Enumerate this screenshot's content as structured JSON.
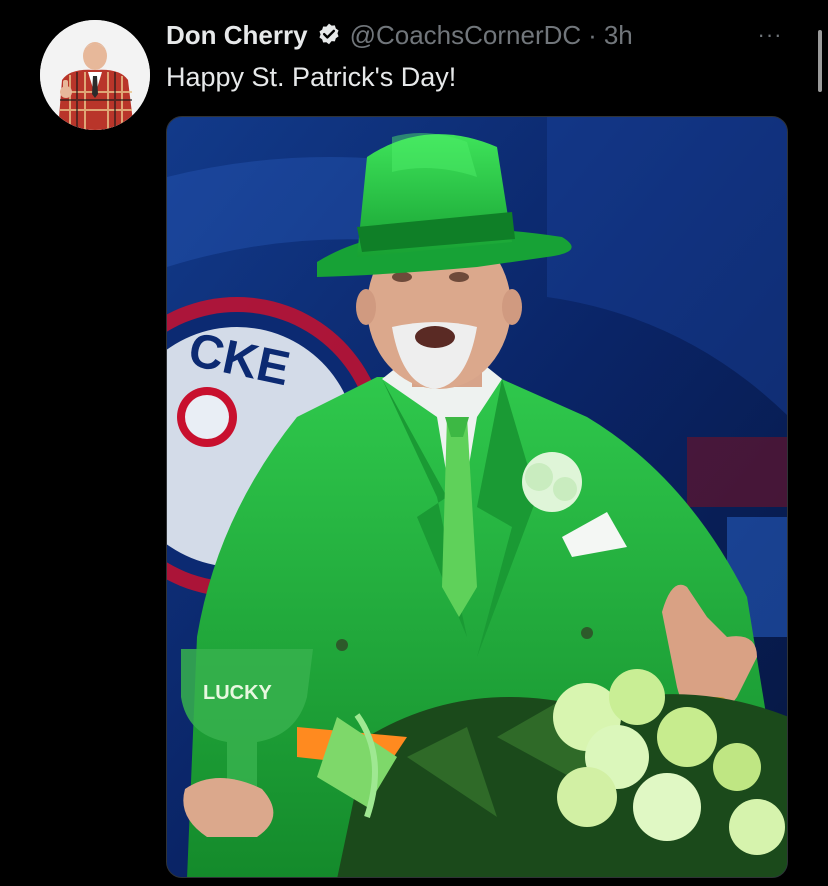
{
  "tweet": {
    "author_name": "Don Cherry",
    "handle": "@CoachsCornerDC",
    "separator": "·",
    "time": "3h",
    "more_label": "···",
    "text": "Happy St. Patrick's Day!"
  },
  "media": {
    "background_sign_text": "CKE",
    "glass_text": "LUCKY"
  },
  "colors": {
    "background": "#000000",
    "primary_text": "#e7e9ea",
    "secondary_text": "#71767b",
    "verified_badge": "#e7e9ea",
    "suit_green": "#1fae3a"
  },
  "icons": {
    "verified": "verified-badge-icon",
    "more": "more-horizontal-icon"
  }
}
